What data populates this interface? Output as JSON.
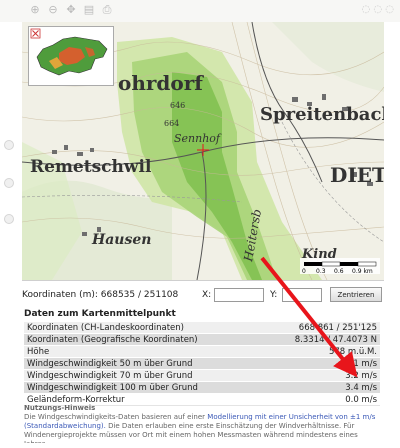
{
  "map": {
    "place_labels": [
      "ohrdorf",
      "Spreitenbach",
      "Sennhof",
      "Remetschwil",
      "DIETIK",
      "Heitersb",
      "Hausen",
      "Kind",
      "646",
      "664"
    ],
    "scale_ticks": [
      "0",
      "0.3",
      "0.6",
      "0.9 km"
    ],
    "icons": [
      "zoom-in-icon",
      "zoom-out-icon",
      "pan-icon",
      "layers-icon",
      "print-icon"
    ]
  },
  "coordinates": {
    "label": "Koordinaten (m):",
    "value": "668535 / 251108",
    "x_label": "X:",
    "y_label": "Y:",
    "center_button": "Zentrieren"
  },
  "section": {
    "title": "Daten zum Kartenmittelpunkt"
  },
  "table": {
    "rows": [
      {
        "label": "Koordinaten (CH-Landeskoordinaten)",
        "value": "668 861 / 251'125",
        "style": "light"
      },
      {
        "label": "Koordinaten (Geografische Koordinaten)",
        "value": "8.3314 / 47.4073 N",
        "style": "dark"
      },
      {
        "label": "Höhe",
        "value": "578 m.ü.M.",
        "style": "light"
      },
      {
        "label": "Windgeschwindigkeit 50 m über Grund",
        "value": "3.1 m/s",
        "style": "dark"
      },
      {
        "label": "Windgeschwindigkeit 70 m über Grund",
        "value": "3.2 m/s",
        "style": "light"
      },
      {
        "label": "Windgeschwindigkeit 100 m über Grund",
        "value": "3.4 m/s",
        "style": "dark"
      },
      {
        "label": "Geländeform-Korrektur",
        "value": "0.0 m/s",
        "style": "plain"
      }
    ]
  },
  "note": {
    "title": "Nutzungs-Hinweis",
    "text_a": "Die Windgeschwindigkeits-Daten basieren auf einer ",
    "text_link": "Modellierung mit einer Unsicherheit von ±1 m/s (Standardabweichung).",
    "text_b": " Die Daten erlauben eine erste Einschätzung der Windverhältnisse. Für Windenergieprojekte müssen vor Ort mit einem hohen Messmasten während mindestens eines Jahres"
  },
  "colors": {
    "arrow": "#e8151b",
    "map_green_light": "#cfe6a6",
    "map_green": "#a9d478",
    "map_green_dark": "#7fc04e"
  }
}
